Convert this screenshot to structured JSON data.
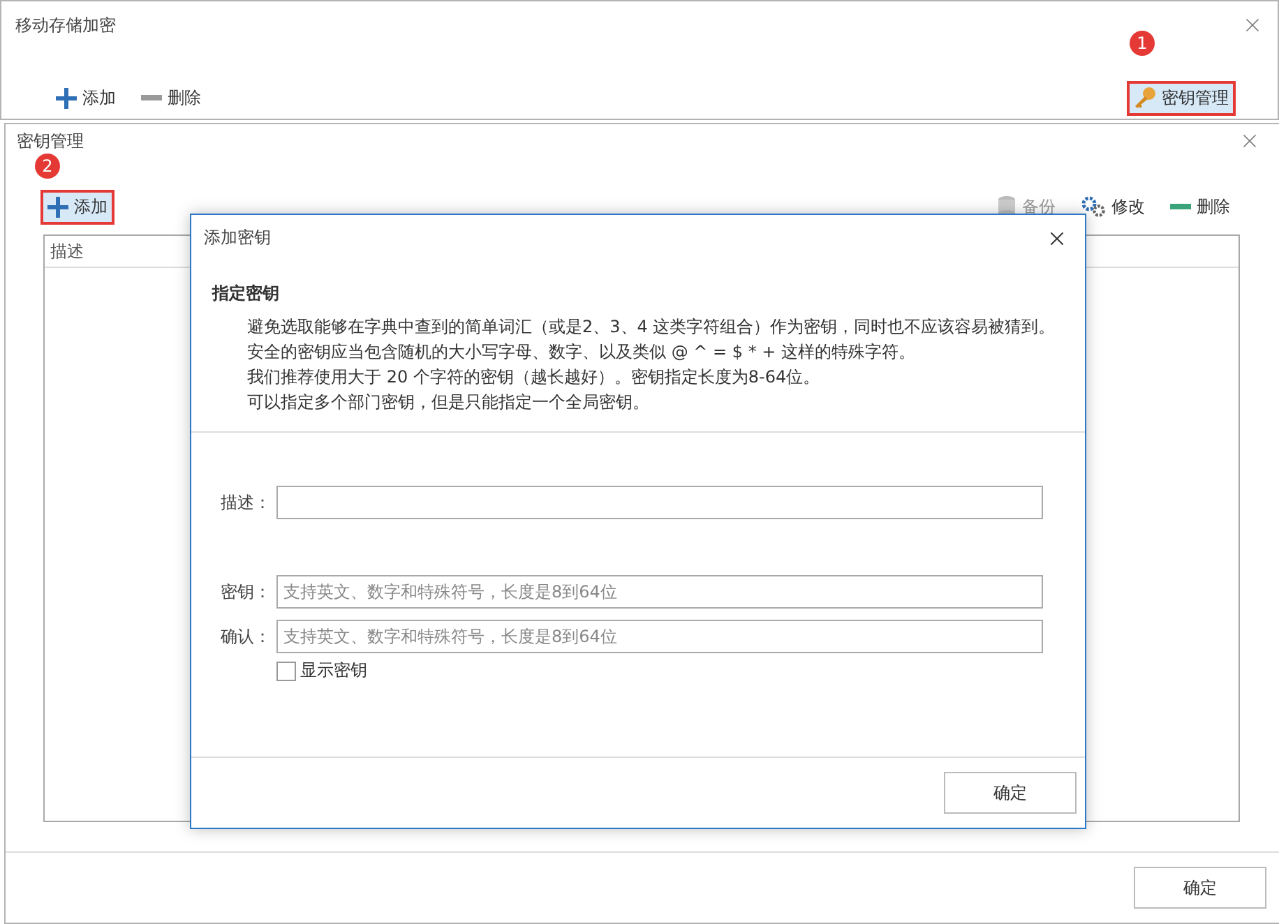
{
  "main_window": {
    "title": "移动存储加密",
    "toolbar": [
      {
        "kind": "add",
        "label": "添加"
      },
      {
        "kind": "remove",
        "label": "删除"
      }
    ],
    "key_button": {
      "label": "密钥管理",
      "highlighted": true,
      "badge": "1"
    }
  },
  "key_window": {
    "title": "密钥管理",
    "toolbar_left": [
      {
        "kind": "add",
        "label": "添加",
        "highlighted": true,
        "badge": "2"
      }
    ],
    "toolbar_right": [
      {
        "kind": "backup",
        "label": "备份",
        "disabled": true
      },
      {
        "kind": "edit",
        "label": "修改",
        "disabled": false
      },
      {
        "kind": "remove",
        "label": "删除",
        "disabled": false
      }
    ],
    "table": {
      "columns": [
        "描述"
      ]
    },
    "ok_button": "确定"
  },
  "dialog": {
    "title": "添加密钥",
    "section_title": "指定密钥",
    "notes": [
      "避免选取能够在字典中查到的简单词汇（或是2、3、4 这类字符组合）作为密钥，同时也不应该容易被猜到。",
      "安全的密钥应当包含随机的大小写字母、数字、以及类似 @ ^ = $ * + 这样的特殊字符。",
      "我们推荐使用大于 20 个字符的密钥（越长越好）。密钥指定长度为8-64位。",
      "可以指定多个部门密钥，但是只能指定一个全局密钥。"
    ],
    "description_field": {
      "label": "描述："
    },
    "key_field": {
      "label": "密钥：",
      "placeholder": "支持英文、数字和特殊符号，长度是8到64位"
    },
    "confirm_field": {
      "label": "确认：",
      "placeholder": "支持英文、数字和特殊符号，长度是8到64位"
    },
    "show_key": {
      "label": "显示密钥",
      "checked": false
    },
    "ok_button": "确定"
  }
}
